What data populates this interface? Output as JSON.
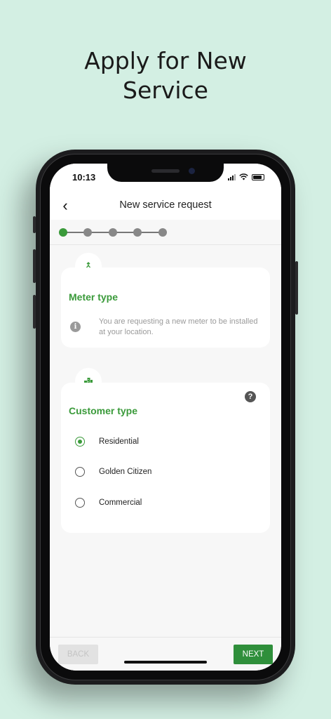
{
  "headline": {
    "line1": "Apply for New",
    "line2": "Service"
  },
  "status_bar": {
    "time": "10:13"
  },
  "appbar": {
    "title": "New service request",
    "back_icon": "chevron-left-icon"
  },
  "stepper": {
    "total_steps": 5,
    "current_step": 1
  },
  "meter_card": {
    "icon": "merge-icon",
    "title": "Meter type",
    "info_icon": "info-icon",
    "info_text": "You are requesting a new meter to be installed at your location."
  },
  "customer_card": {
    "icon": "buildings-icon",
    "title": "Customer type",
    "help_icon": "help-icon",
    "options": [
      {
        "label": "Residential",
        "selected": true
      },
      {
        "label": "Golden Citizen",
        "selected": false
      },
      {
        "label": "Commercial",
        "selected": false
      }
    ]
  },
  "footer": {
    "back_label": "BACK",
    "next_label": "NEXT"
  },
  "colors": {
    "accent": "#3a9a3a",
    "next_button": "#2f8f3b",
    "background": "#d3efe3"
  }
}
